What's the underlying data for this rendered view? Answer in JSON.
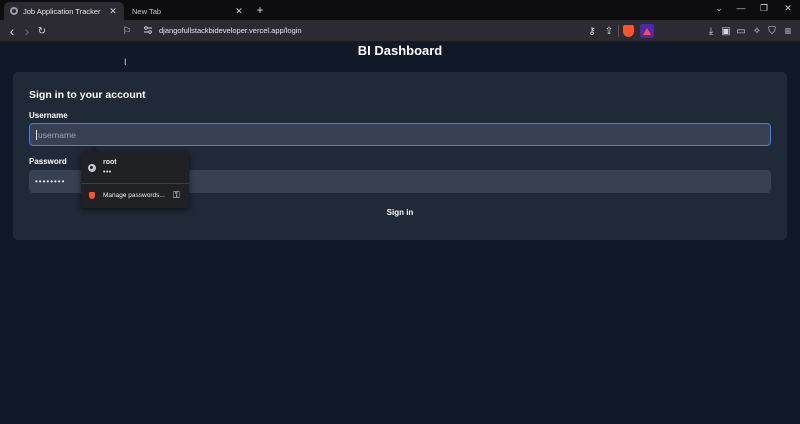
{
  "browser": {
    "tabs": [
      {
        "title": "Job Application Tracker",
        "active": true
      },
      {
        "title": "New Tab",
        "active": false
      }
    ],
    "close_glyph": "✕",
    "new_tab_glyph": "+",
    "window_controls": {
      "tab_list": "⌄",
      "minimize": "—",
      "restore": "❐",
      "close": "✕"
    },
    "url": "djangofullstackbideveloper.vercel.app/login",
    "icons": {
      "back": "‹",
      "forward": "›",
      "reload": "↻",
      "bookmark": "⚐",
      "key": "⚷",
      "share": "⇪",
      "download": "⤓",
      "sidebar": "▣",
      "wallet": "▭",
      "leo": "✧",
      "vpn": "⛉",
      "menu": "≡"
    }
  },
  "page": {
    "title": "BI Dashboard"
  },
  "login": {
    "heading": "Sign in to your account",
    "username_label": "Username",
    "username_placeholder": "username",
    "password_label": "Password",
    "password_value": "••••••••",
    "submit_label": "Sign in"
  },
  "autofill": {
    "suggestion_username": "root",
    "suggestion_password": "•••",
    "manage_label": "Manage passwords...",
    "key_glyph": "⚿"
  },
  "colors": {
    "page_bg": "#111827",
    "card_bg": "#1f2937",
    "input_bg": "#374151",
    "focus_ring": "#3b82f6",
    "brave_orange": "#fb542b"
  }
}
